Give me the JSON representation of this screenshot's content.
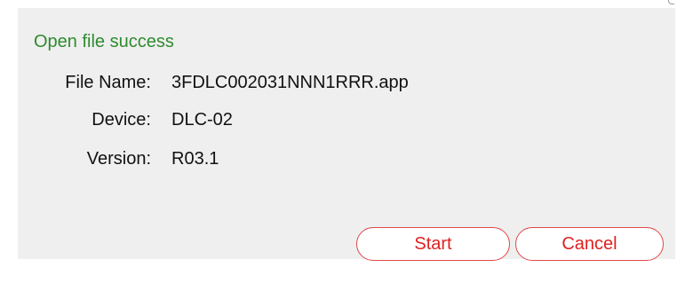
{
  "dialog": {
    "status_text": "Open file success",
    "fields": [
      {
        "label": "File Name:",
        "value": "3FDLC002031NNN1RRR.app"
      },
      {
        "label": "Device:",
        "value": "DLC-02"
      },
      {
        "label": "Version:",
        "value": "R03.1"
      }
    ],
    "buttons": {
      "start_label": "Start",
      "cancel_label": "Cancel"
    }
  },
  "colors": {
    "status_green": "#2e8b2e",
    "button_red": "#e02020",
    "dialog_bg": "#efefef"
  }
}
